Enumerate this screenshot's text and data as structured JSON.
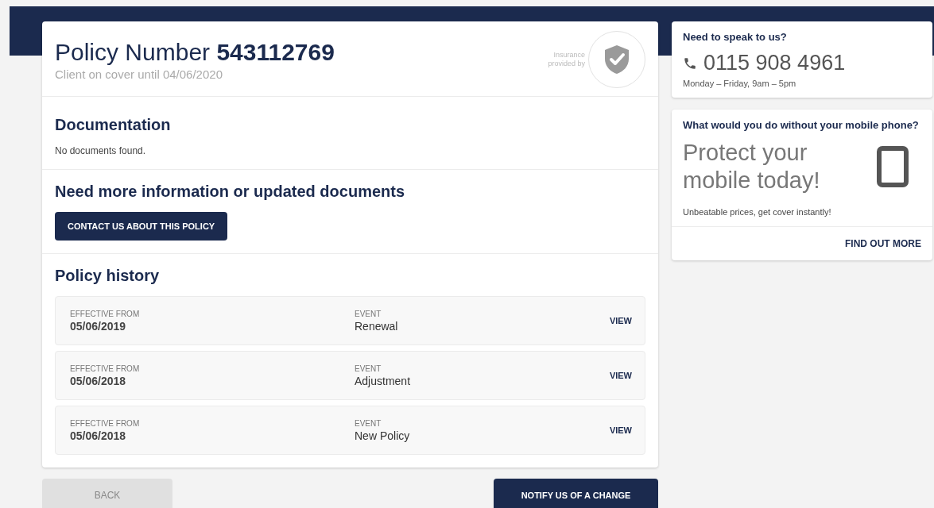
{
  "policy": {
    "title": "Policy Number",
    "number": "543112769",
    "cover_note": "Client on cover until 04/06/2020",
    "insurer_label": "Insurance provided by"
  },
  "documentation": {
    "heading": "Documentation",
    "empty_text": "No documents found."
  },
  "more_info": {
    "heading": "Need more information or updated documents",
    "button": "CONTACT US ABOUT THIS POLICY"
  },
  "history": {
    "heading": "Policy history",
    "rows": [
      {
        "date_label": "EFFECTIVE FROM",
        "date": "05/06/2019",
        "event_label": "EVENT",
        "event": "Renewal",
        "action": "VIEW"
      },
      {
        "date_label": "EFFECTIVE FROM",
        "date": "05/06/2018",
        "event_label": "EVENT",
        "event": "Adjustment",
        "action": "VIEW"
      },
      {
        "date_label": "EFFECTIVE FROM",
        "date": "05/06/2018",
        "event_label": "EVENT",
        "event": "New Policy",
        "action": "VIEW"
      }
    ]
  },
  "footer": {
    "back": "BACK",
    "notify": "NOTIFY US OF A CHANGE"
  },
  "contact": {
    "heading": "Need to speak to us?",
    "phone": "0115 908 4961",
    "hours": "Monday – Friday, 9am – 5pm"
  },
  "promo": {
    "heading": "What would you do without your mobile phone?",
    "headline": "Protect your mobile today!",
    "text": "Unbeatable prices, get cover instantly!",
    "link": "FIND OUT MORE"
  }
}
